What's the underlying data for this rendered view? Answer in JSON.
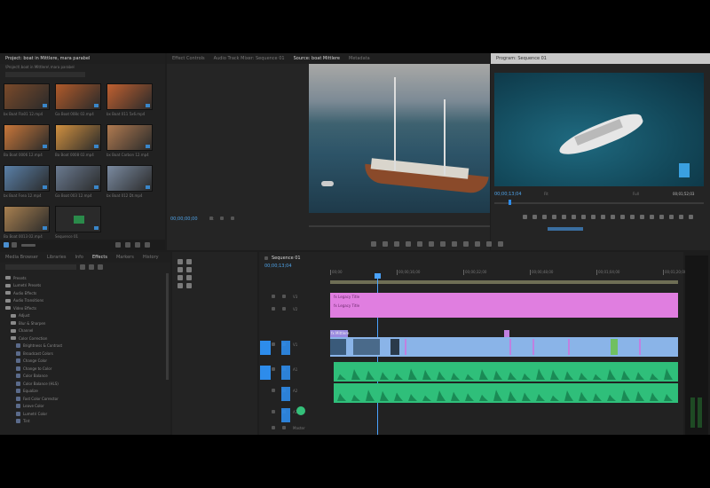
{
  "project": {
    "title": "Project: boat in Mittlere, mara parabel",
    "path": "\\Project\\ boat in Mittlere\\ mara parabel",
    "items": [
      {
        "name": "bx Boat Fla01 12.mp4",
        "thumb": "#7a4a2a"
      },
      {
        "name": "Ga Boat 008c 02.mp4",
        "thumb": "#b05a2a"
      },
      {
        "name": "bx Boat 011 5x6.mp4",
        "thumb": "#c06030"
      },
      {
        "name": "Ba Boat 0006 12.mp4",
        "thumb": "#c8773a"
      },
      {
        "name": "Ba Boat 0008 02.mp4",
        "thumb": "#d09040"
      },
      {
        "name": "bx Boat Carbon 12.mp4",
        "thumb": "#b07a50"
      },
      {
        "name": "bx Boat Fsea 12.mp4",
        "thumb": "#5a80a8"
      },
      {
        "name": "Ga Boat 003 12.mp4",
        "thumb": "#6a7a90"
      },
      {
        "name": "bx Boat 012 Dt.mp4",
        "thumb": "#7a8aa0"
      },
      {
        "name": "Ba Boat 0013 02.mp4",
        "thumb": "#a88050"
      },
      {
        "name": "Sequence 01",
        "thumb": "#3a3a3a"
      }
    ]
  },
  "source_tabs": [
    "Effect Controls",
    "Audio Track Mixer: Sequence 01",
    "Source: boat Mittlere",
    "Metadata"
  ],
  "program_tabs": [
    "Program: Sequence 01"
  ],
  "source_timecode": "00;00;00;00",
  "program_timecode": "00;00;13;04",
  "program_duration": "00;01;52;03",
  "fit_label": "Fit",
  "full_label": "Full",
  "effects_tabs": [
    "Media Browser",
    "Libraries",
    "Info",
    "Effects",
    "Markers",
    "History"
  ],
  "effects_tree": [
    {
      "label": "Presets",
      "indent": 0
    },
    {
      "label": "Lumetri Presets",
      "indent": 0
    },
    {
      "label": "Audio Effects",
      "indent": 0
    },
    {
      "label": "Audio Transitions",
      "indent": 0
    },
    {
      "label": "Video Effects",
      "indent": 0
    },
    {
      "label": "Adjust",
      "indent": 1
    },
    {
      "label": "Blur & Sharpen",
      "indent": 1
    },
    {
      "label": "Channel",
      "indent": 1
    },
    {
      "label": "Color Correction",
      "indent": 1
    },
    {
      "label": "Brightness & Contrast",
      "indent": 2
    },
    {
      "label": "Broadcast Colors",
      "indent": 2
    },
    {
      "label": "Change Color",
      "indent": 2
    },
    {
      "label": "Change to Color",
      "indent": 2
    },
    {
      "label": "Color Balance",
      "indent": 2
    },
    {
      "label": "Color Balance (HLS)",
      "indent": 2
    },
    {
      "label": "Equalize",
      "indent": 2
    },
    {
      "label": "Fast Color Corrector",
      "indent": 2
    },
    {
      "label": "Leave Color",
      "indent": 2
    },
    {
      "label": "Lumetri Color",
      "indent": 2
    },
    {
      "label": "Tint",
      "indent": 2
    }
  ],
  "timeline": {
    "sequence_name": "Sequence 01",
    "timecode": "00;00;13;04",
    "ruler": [
      "00;00",
      "00;00;16;00",
      "00;00;32;00",
      "00;00;48;00",
      "00;01;04;00",
      "00;01;20;00"
    ],
    "tracks": [
      "V3",
      "V2",
      "V1",
      "A1",
      "A2",
      "A3",
      "Master"
    ],
    "title_clip": "fx Legacy Title",
    "overlay_clip": "fx Mittlere"
  },
  "colors": {
    "accent": "#2d8ceb",
    "title_clip": "#e07ee0",
    "video_clip": "#8ab4e8",
    "audio_clip": "#2fbf7a",
    "audio_dark": "#1a8a55"
  }
}
